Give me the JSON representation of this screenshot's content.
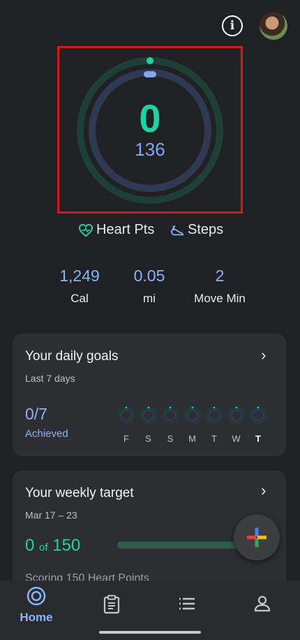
{
  "summary": {
    "heart_points": "0",
    "steps": "136"
  },
  "legend": {
    "heart_pts_label": "Heart Pts",
    "steps_label": "Steps"
  },
  "stats": [
    {
      "value": "1,249",
      "label": "Cal"
    },
    {
      "value": "0.05",
      "label": "mi"
    },
    {
      "value": "2",
      "label": "Move Min"
    }
  ],
  "daily_goals": {
    "title": "Your daily goals",
    "subtitle": "Last 7 days",
    "achieved_count": "0/7",
    "achieved_label": "Achieved",
    "days": [
      "F",
      "S",
      "S",
      "M",
      "T",
      "W",
      "T"
    ]
  },
  "weekly_target": {
    "title": "Your weekly target",
    "date_range": "Mar 17 – 23",
    "current": "0",
    "of": "of",
    "target": "150",
    "progress": 0,
    "description": "Scoring 150 Heart Points"
  },
  "nav": {
    "home_label": "Home"
  },
  "colors": {
    "heart": "#1ed3a2",
    "steps": "#8ab4f8",
    "background": "#202124"
  },
  "icons": [
    "info-icon",
    "heart-icon",
    "steps-icon",
    "chevron-right-icon",
    "plus-icon",
    "home-icon",
    "journal-icon",
    "browse-icon",
    "profile-icon"
  ]
}
